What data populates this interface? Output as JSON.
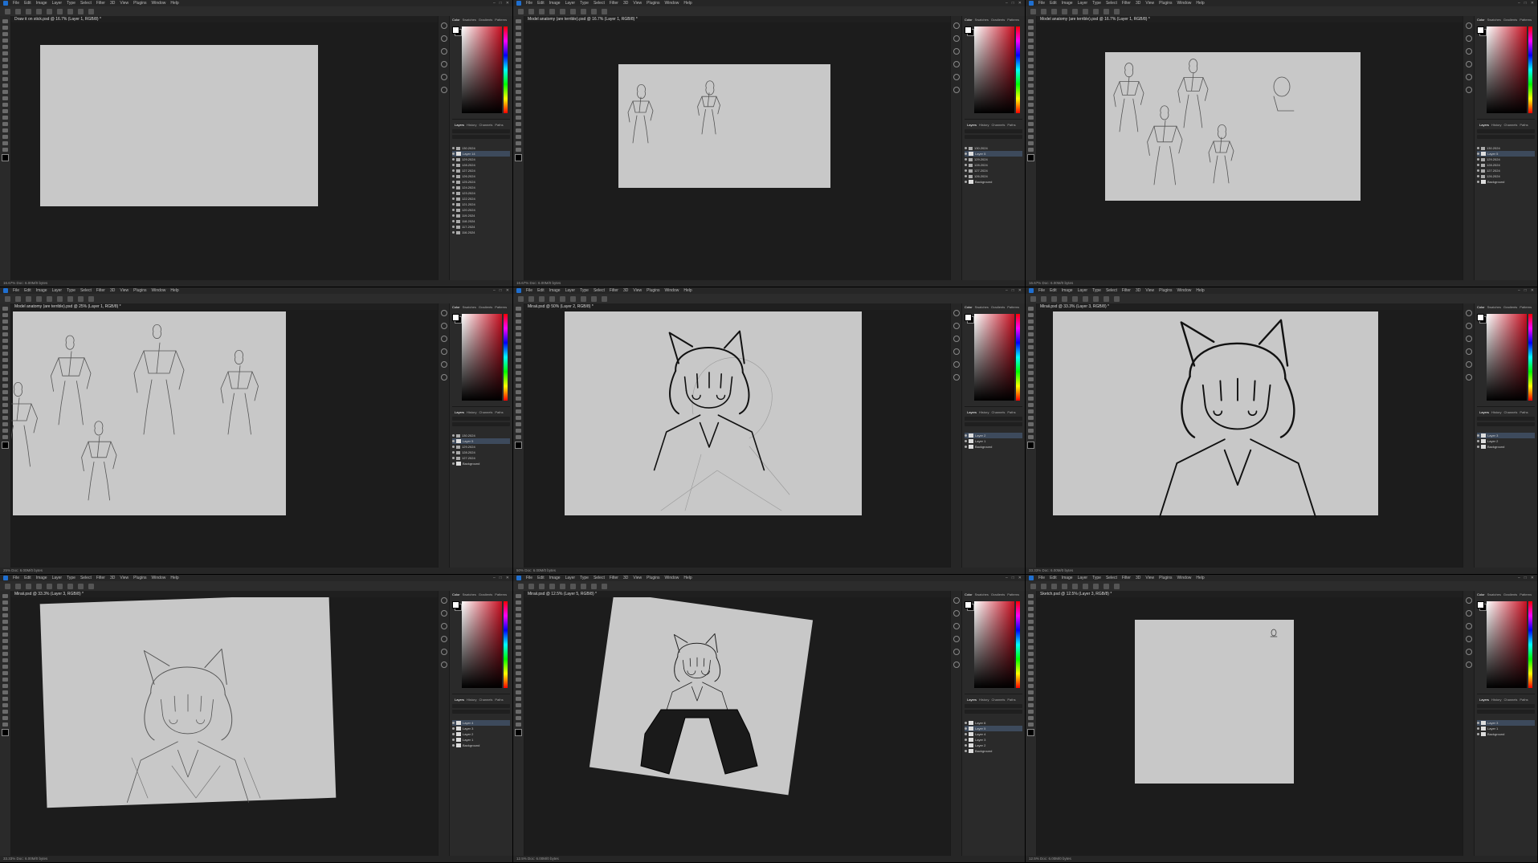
{
  "menu": [
    "File",
    "Edit",
    "Image",
    "Layer",
    "Type",
    "Select",
    "Filter",
    "3D",
    "View",
    "Plugins",
    "Window",
    "Help"
  ],
  "panel_tabs": [
    "Color",
    "Swatches",
    "Gradients",
    "Patterns"
  ],
  "layer_tabs": [
    "Layers",
    "History",
    "Channels",
    "Paths"
  ],
  "colors": {
    "app_bg": "#1c1c1c",
    "panel_bg": "#2a2a2a",
    "paper": "#c8c8c8",
    "picker_red": "#c81022",
    "selection": "#3d4a5c"
  },
  "panes": [
    {
      "title": "Draw it on stick.psd @ 16.7% (Layer 1, RGB/8) *",
      "status": "16.67%   Doc: 6.00M/0 bytes",
      "layers": [
        {
          "kind": "folder",
          "label": "130.2024"
        },
        {
          "kind": "layer",
          "label": "Layer 14",
          "selected": true
        },
        {
          "kind": "folder",
          "label": "129.2024"
        },
        {
          "kind": "folder",
          "label": "128.2024"
        },
        {
          "kind": "folder",
          "label": "127.2024"
        },
        {
          "kind": "folder",
          "label": "126.2024"
        },
        {
          "kind": "folder",
          "label": "125.2024"
        },
        {
          "kind": "folder",
          "label": "124.2024"
        },
        {
          "kind": "folder",
          "label": "123.2024"
        },
        {
          "kind": "folder",
          "label": "122.2024"
        },
        {
          "kind": "folder",
          "label": "121.2024"
        },
        {
          "kind": "folder",
          "label": "120.2024"
        },
        {
          "kind": "folder",
          "label": "119.2024"
        },
        {
          "kind": "folder",
          "label": "118.2024"
        },
        {
          "kind": "folder",
          "label": "117.2024"
        },
        {
          "kind": "folder",
          "label": "116.2024"
        }
      ]
    },
    {
      "title": "Model anatomy (are terrible).psd @ 16.7% (Layer 1, RGB/8) *",
      "status": "16.67%   Doc: 6.00M/0 bytes",
      "layers": [
        {
          "kind": "folder",
          "label": "130.2024"
        },
        {
          "kind": "layer",
          "label": "Layer 5",
          "selected": true
        },
        {
          "kind": "folder",
          "label": "129.2024"
        },
        {
          "kind": "folder",
          "label": "128.2024"
        },
        {
          "kind": "folder",
          "label": "127.2024"
        },
        {
          "kind": "folder",
          "label": "126.2024"
        },
        {
          "kind": "layer",
          "label": "Background"
        }
      ]
    },
    {
      "title": "Model anatomy (are terrible).psd @ 16.7% (Layer 1, RGB/8) *",
      "status": "16.67%   Doc: 6.00M/0 bytes",
      "layers": [
        {
          "kind": "folder",
          "label": "130.2024"
        },
        {
          "kind": "layer",
          "label": "Layer 5",
          "selected": true
        },
        {
          "kind": "folder",
          "label": "129.2024"
        },
        {
          "kind": "folder",
          "label": "128.2024"
        },
        {
          "kind": "folder",
          "label": "127.2024"
        },
        {
          "kind": "folder",
          "label": "126.2024"
        },
        {
          "kind": "layer",
          "label": "Background"
        }
      ]
    },
    {
      "title": "Model anatomy (are terrible).psd @ 25% (Layer 1, RGB/8) *",
      "status": "25%   Doc: 6.00M/0 bytes",
      "layers": [
        {
          "kind": "folder",
          "label": "130.2024"
        },
        {
          "kind": "layer",
          "label": "Layer 5",
          "selected": true
        },
        {
          "kind": "folder",
          "label": "129.2024"
        },
        {
          "kind": "folder",
          "label": "128.2024"
        },
        {
          "kind": "folder",
          "label": "127.2024"
        },
        {
          "kind": "layer",
          "label": "Background"
        }
      ]
    },
    {
      "title": "Miraii.psd @ 50% (Layer 2, RGB/8) *",
      "status": "50%   Doc: 6.00M/0 bytes",
      "layers": [
        {
          "kind": "layer",
          "label": "Layer 2",
          "selected": true
        },
        {
          "kind": "layer",
          "label": "Layer 1"
        },
        {
          "kind": "layer",
          "label": "Background"
        }
      ]
    },
    {
      "title": "Miraii.psd @ 33.3% (Layer 3, RGB/8) *",
      "status": "33.33%   Doc: 6.00M/0 bytes",
      "layers": [
        {
          "kind": "layer",
          "label": "Layer 3",
          "selected": true
        },
        {
          "kind": "layer",
          "label": "Layer 2"
        },
        {
          "kind": "layer",
          "label": "Background"
        }
      ]
    },
    {
      "title": "Miraii.psd @ 33.3% (Layer 3, RGB/8) *",
      "status": "33.33%   Doc: 6.00M/0 bytes",
      "layers": [
        {
          "kind": "layer",
          "label": "Layer 4",
          "selected": true
        },
        {
          "kind": "layer",
          "label": "Layer 3"
        },
        {
          "kind": "layer",
          "label": "Layer 2"
        },
        {
          "kind": "layer",
          "label": "Layer 1"
        },
        {
          "kind": "layer",
          "label": "Background"
        }
      ]
    },
    {
      "title": "Miraii.psd @ 12.5% (Layer 5, RGB/8) *",
      "status": "12.5%   Doc: 6.00M/0 bytes",
      "layers": [
        {
          "kind": "layer",
          "label": "Layer 6"
        },
        {
          "kind": "layer",
          "label": "Layer 5",
          "selected": true
        },
        {
          "kind": "layer",
          "label": "Layer 4"
        },
        {
          "kind": "layer",
          "label": "Layer 3"
        },
        {
          "kind": "layer",
          "label": "Layer 2"
        },
        {
          "kind": "layer",
          "label": "Background"
        }
      ]
    },
    {
      "title": "Sketch.psd @ 12.5% (Layer 3, RGB/8) *",
      "status": "12.5%   Doc: 6.00M/0 bytes",
      "layers": [
        {
          "kind": "layer",
          "label": "Layer 3",
          "selected": true
        },
        {
          "kind": "layer",
          "label": "Layer 1"
        },
        {
          "kind": "layer",
          "label": "Background"
        }
      ]
    }
  ]
}
